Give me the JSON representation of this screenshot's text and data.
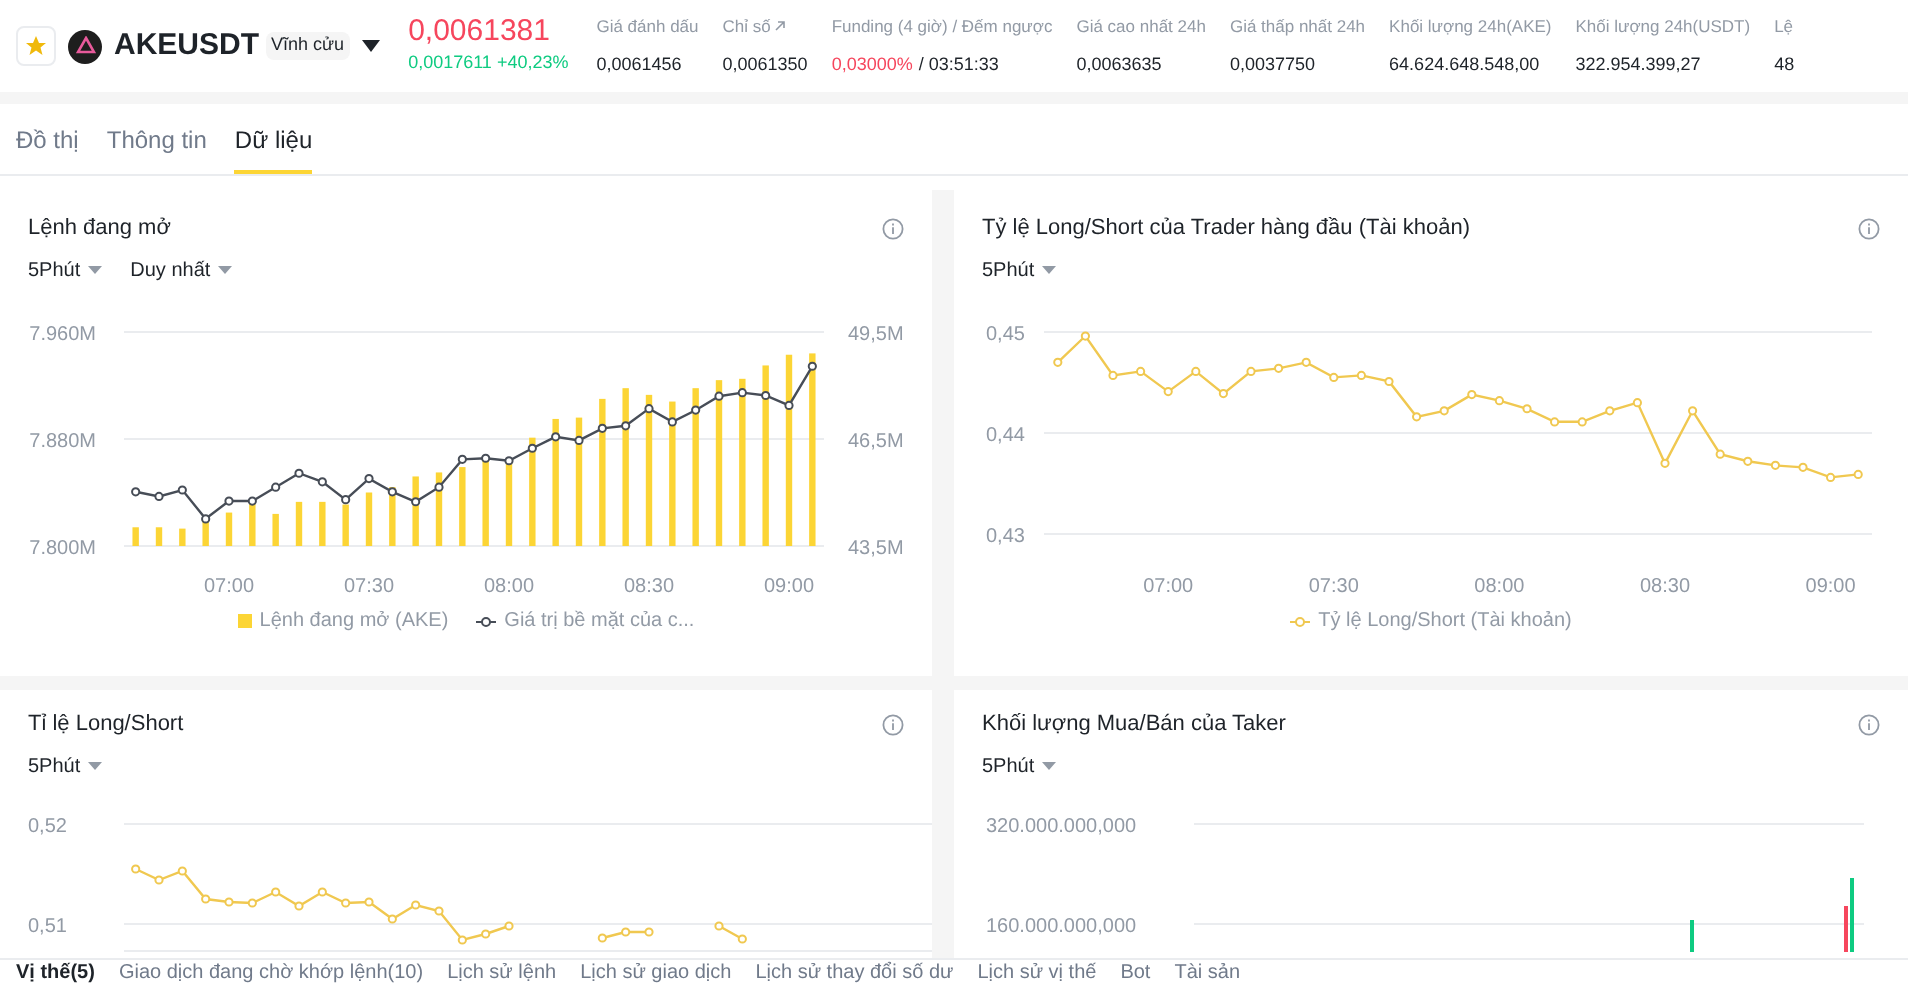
{
  "header": {
    "symbol": "AKEUSDT",
    "badge": "Vĩnh cửu",
    "price": "0,0061381",
    "change": "0,0017611 +40,23%",
    "stats": [
      {
        "label": "Giá đánh dấu",
        "value": "0,0061456"
      },
      {
        "label": "Chỉ số",
        "value": "0,0061350",
        "link": true
      },
      {
        "label": "Funding (4 giờ) / Đếm ngược",
        "rate": "0,03000%",
        "value": "/ 03:51:33"
      },
      {
        "label": "Giá cao nhất 24h",
        "value": "0,0063635"
      },
      {
        "label": "Giá thấp nhất 24h",
        "value": "0,0037750"
      },
      {
        "label": "Khối lượng 24h(AKE)",
        "value": "64.624.648.548,00"
      },
      {
        "label": "Khối lượng 24h(USDT)",
        "value": "322.954.399,27"
      },
      {
        "label": "Lệ",
        "value": "48"
      }
    ]
  },
  "tabs": [
    {
      "label": "Đồ thị",
      "selected": false
    },
    {
      "label": "Thông tin",
      "selected": false
    },
    {
      "label": "Dữ liệu",
      "selected": true
    }
  ],
  "panels": [
    {
      "title": "Lệnh đang mở",
      "controls": [
        "5Phút",
        "Duy nhất"
      ],
      "chart_data": {
        "type": "bar",
        "categories": [
          null,
          null,
          null,
          null,
          "07:00",
          null,
          null,
          null,
          null,
          null,
          "07:30",
          null,
          null,
          null,
          null,
          null,
          "08:00",
          null,
          null,
          null,
          null,
          null,
          "08:30",
          null,
          null,
          null,
          null,
          null,
          "09:00",
          null
        ],
        "ylim": [
          7800,
          7960
        ],
        "yticks": [
          {
            "value": 7800,
            "label": "7.800M"
          },
          {
            "value": 7880,
            "label": "7.880M"
          },
          {
            "value": 7960,
            "label": "7.960M"
          }
        ],
        "y2lim": [
          43.5,
          49.5
        ],
        "y2ticks": [
          {
            "value": 43.5,
            "label": "43,5M"
          },
          {
            "value": 46.5,
            "label": "46,5M"
          },
          {
            "value": 49.5,
            "label": "49,5M"
          }
        ],
        "series": [
          {
            "name": "Lệnh đang mở (AKE)",
            "color": "#fcd535",
            "values": [
              7814,
              7814,
              7813,
              7820,
              7825,
              7833,
              7824,
              7833,
              7833,
              7831,
              7840,
              7844,
              7852,
              7855,
              7859,
              7864,
              7864,
              7881,
              7895,
              7896,
              7910,
              7918,
              7913,
              7908,
              7918,
              7924,
              7925,
              7935,
              7943,
              7944
            ]
          },
          {
            "name": "Giá trị bề mặt của c...",
            "type": "line",
            "axis": "y2",
            "marker": "circle",
            "color": "#474d57",
            "values": [
              45.02,
              44.89,
              45.07,
              44.26,
              44.76,
              44.76,
              45.15,
              45.54,
              45.3,
              44.8,
              45.39,
              45.02,
              44.74,
              45.15,
              45.93,
              45.96,
              45.89,
              46.24,
              46.56,
              46.46,
              46.8,
              46.87,
              47.35,
              46.98,
              47.31,
              47.7,
              47.8,
              47.72,
              47.44,
              48.54
            ]
          }
        ]
      }
    },
    {
      "title": "Tỷ lệ Long/Short của Trader hàng đầu (Tài khoản)",
      "controls": [
        "5Phút"
      ],
      "chart_data": {
        "type": "line",
        "categories": [
          null,
          null,
          null,
          null,
          "07:00",
          null,
          null,
          null,
          null,
          null,
          "07:30",
          null,
          null,
          null,
          null,
          null,
          "08:00",
          null,
          null,
          null,
          null,
          null,
          "08:30",
          null,
          null,
          null,
          null,
          null,
          "09:00",
          null
        ],
        "ylim": [
          0.43,
          0.45
        ],
        "yticks": [
          {
            "value": 0.43,
            "label": "0,43"
          },
          {
            "value": 0.44,
            "label": "0,44"
          },
          {
            "value": 0.45,
            "label": "0,45"
          }
        ],
        "series": [
          {
            "name": "Tỷ lệ Long/Short (Tài khoản)",
            "marker": "circle",
            "color": "#f0c850",
            "values": [
              0.447,
              0.4496,
              0.4457,
              0.4461,
              0.4441,
              0.4461,
              0.4439,
              0.4461,
              0.4464,
              0.447,
              0.4455,
              0.4457,
              0.4451,
              0.4416,
              0.4422,
              0.4438,
              0.4432,
              0.4424,
              0.4411,
              0.4411,
              0.4422,
              0.443,
              0.437,
              0.4422,
              0.4379,
              0.4372,
              0.4368,
              0.4366,
              0.4356,
              0.4359
            ]
          }
        ]
      }
    },
    {
      "title": "Tỉ lệ Long/Short",
      "controls": [
        "5Phút"
      ],
      "chart_data": {
        "type": "line",
        "ylim": [
          0.5072,
          0.52
        ],
        "yticks": [
          {
            "value": 0.51,
            "label": "0,51"
          },
          {
            "value": 0.52,
            "label": "0,52"
          }
        ],
        "series": [
          {
            "marker": "circle",
            "color": "#f0c850",
            "values": [
              0.5155,
              0.5144,
              0.5153,
              0.5125,
              0.5122,
              0.5121,
              0.5132,
              0.5118,
              0.5132,
              0.5121,
              0.5122,
              0.5105,
              0.5119,
              0.5113,
              0.5084,
              0.509,
              0.5098,
              null,
              null,
              null,
              0.5086,
              0.5092,
              0.5092,
              null,
              null,
              0.5098,
              0.5085,
              null,
              null,
              null
            ]
          }
        ]
      }
    },
    {
      "title": "Khối lượng Mua/Bán của Taker",
      "controls": [
        "5Phút"
      ],
      "y_labels": [
        "320.000.000,000",
        "160.000.000,000"
      ]
    }
  ],
  "bottom_tabs": [
    {
      "label": "Vị thế(5)",
      "selected": true
    },
    {
      "label": "Giao dịch đang chờ khớp lệnh(10)",
      "selected": false
    },
    {
      "label": "Lịch sử lệnh",
      "selected": false
    },
    {
      "label": "Lịch sử giao dịch",
      "selected": false
    },
    {
      "label": "Lịch sử thay đổi số dư",
      "selected": false
    },
    {
      "label": "Lịch sử vị thế",
      "selected": false
    },
    {
      "label": "Bot",
      "selected": false
    },
    {
      "label": "Tài sản",
      "selected": false
    }
  ]
}
